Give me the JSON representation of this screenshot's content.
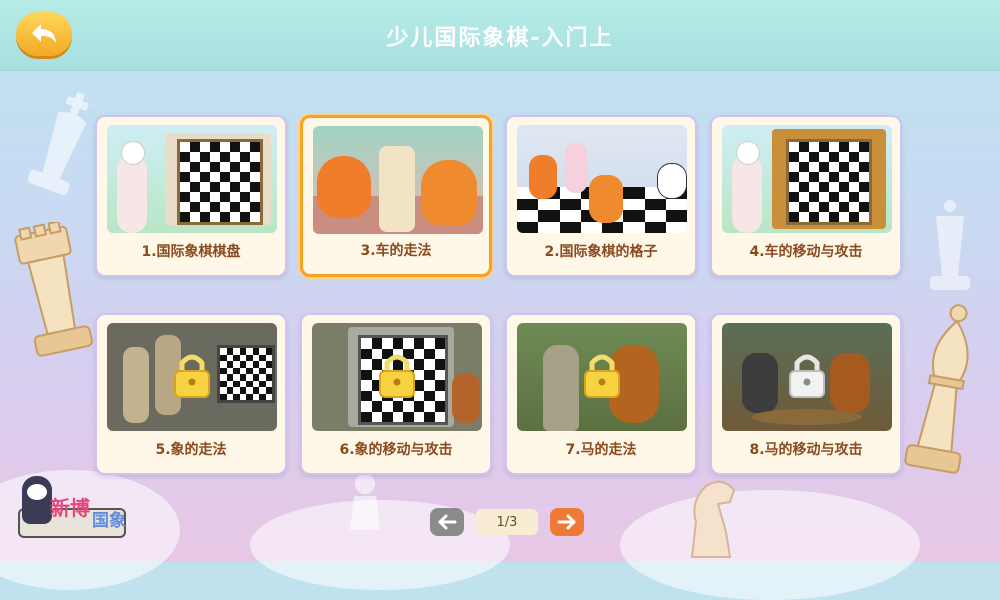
{
  "header": {
    "title": "少儿国际象棋-入门上"
  },
  "lessons": [
    {
      "label": "1.国际象棋棋盘",
      "locked": false
    },
    {
      "label": "3.车的走法",
      "locked": false,
      "selected": true
    },
    {
      "label": "2.国际象棋的格子",
      "locked": false
    },
    {
      "label": "4.车的移动与攻击",
      "locked": false
    },
    {
      "label": "5.象的走法",
      "locked": true
    },
    {
      "label": "6.象的移动与攻击",
      "locked": true
    },
    {
      "label": "7.马的走法",
      "locked": true
    },
    {
      "label": "8.马的移动与攻击",
      "locked": true
    }
  ],
  "pager": {
    "current": "1/3"
  },
  "logo": {
    "line1": "新博",
    "line2": "国象"
  },
  "colors": {
    "accent": "#f5a323",
    "label": "#8a4a1e",
    "next": "#ef7a37"
  }
}
